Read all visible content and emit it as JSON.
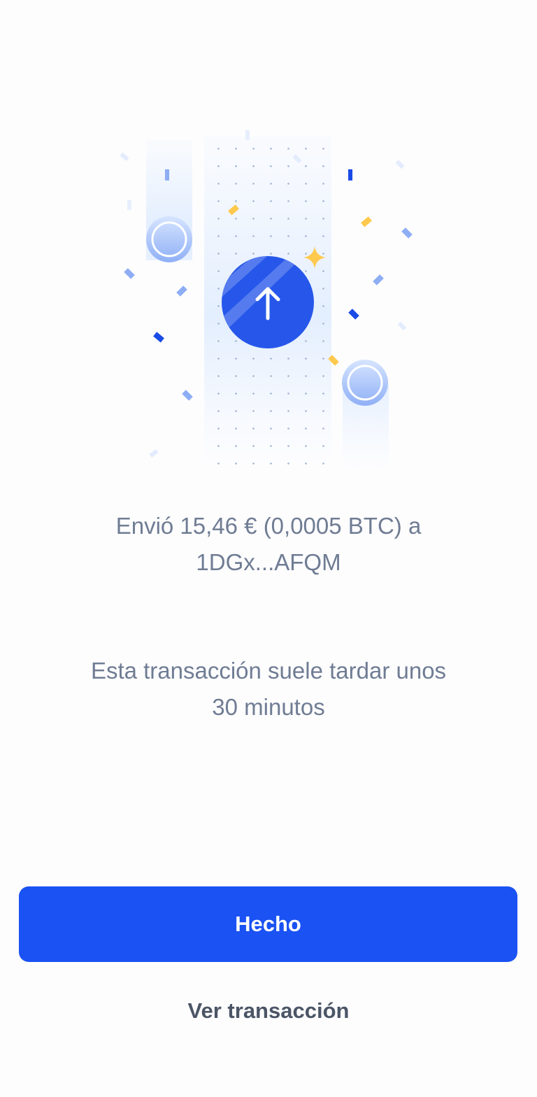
{
  "illustration": {
    "icon": "arrow-up-icon",
    "accent_color": "#1a52f3",
    "confetti_yellow": "#ffc94d"
  },
  "confirmation": {
    "sent_line_1": "Envió 15,46 € (0,0005 BTC) a",
    "sent_line_2": "1DGx...AFQM",
    "eta_line_1": "Esta transacción suele tardar unos",
    "eta_line_2": "30 minutos"
  },
  "actions": {
    "done_label": "Hecho",
    "view_label": "Ver transacción"
  },
  "colors": {
    "primary_button": "#1a52f3",
    "body_text": "#6f7c93",
    "secondary_text": "#4b5566"
  }
}
